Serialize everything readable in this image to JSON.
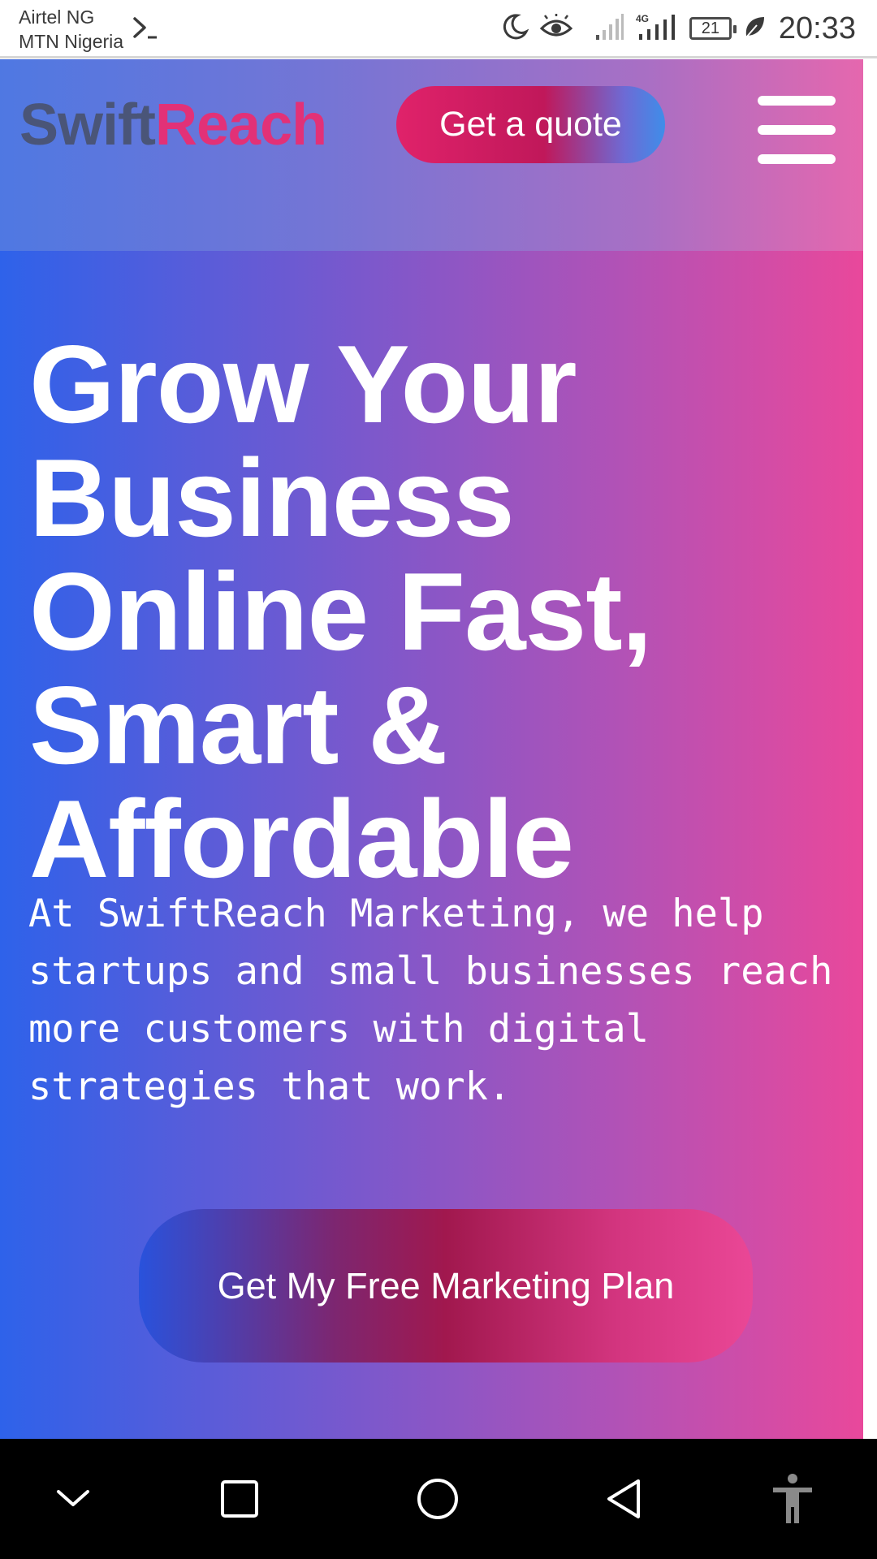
{
  "status_bar": {
    "carrier_1": "Airtel NG",
    "carrier_2": "MTN Nigeria",
    "battery": "21",
    "time": "20:33",
    "icons": [
      "terminal-icon",
      "moon-icon",
      "eye-icon",
      "signal-icon",
      "4g-signal-icon",
      "battery-icon",
      "leaf-icon"
    ]
  },
  "header": {
    "logo_part1": "Swift",
    "logo_part2": "Reach",
    "quote_button": "Get a quote",
    "menu_icon": "hamburger-menu-icon"
  },
  "hero": {
    "title": "Grow Your Business Online Fast, Smart & Affordable",
    "description": "At SwiftReach Marketing, we help startups and small businesses reach more customers with digital strategies that work.",
    "cta_button": "Get My Free Marketing Plan"
  },
  "nav_bar": {
    "icons": [
      "chevron-down-icon",
      "recents-square-icon",
      "home-circle-icon",
      "back-triangle-icon",
      "accessibility-icon"
    ]
  },
  "colors": {
    "logo_swift": "#4a5578",
    "logo_reach": "#e23177",
    "hero_gradient_start": "#2e62ea",
    "hero_gradient_end": "#e9489b",
    "status_text": "#3a3a3a"
  }
}
